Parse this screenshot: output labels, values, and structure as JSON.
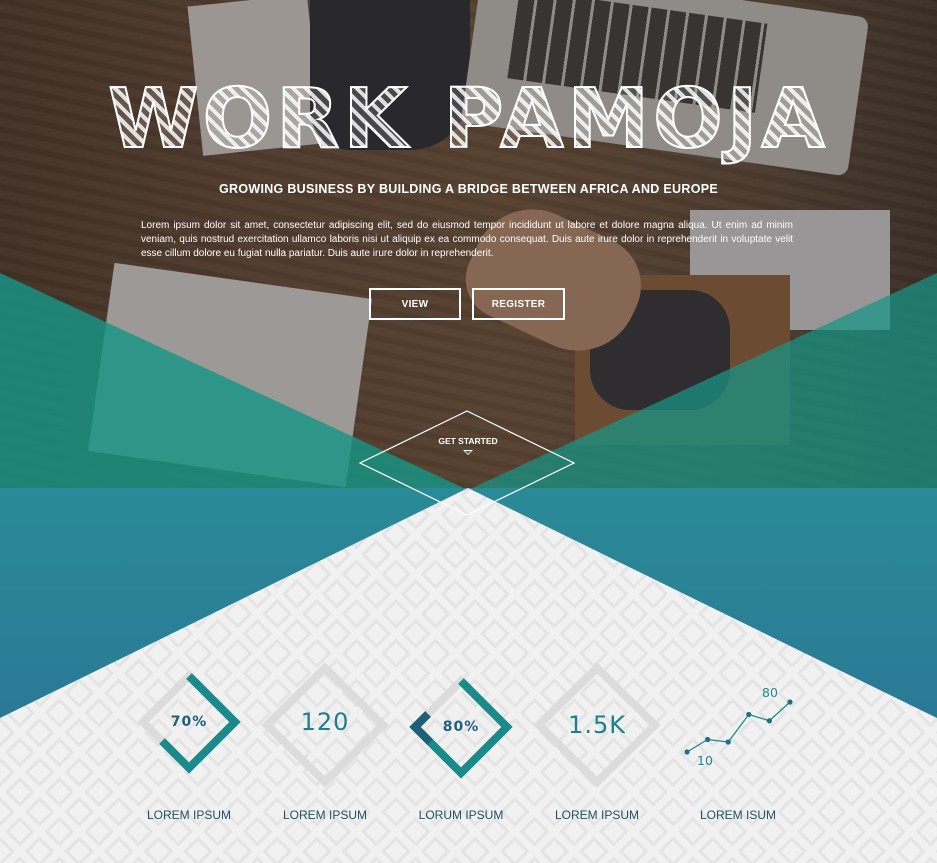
{
  "hero": {
    "title": "WORK PAMOJA",
    "subtitle": "GROWING BUSINESS BY BUILDING A BRIDGE BETWEEN AFRICA AND EUROPE",
    "body": "Lorem ipsum dolor sit amet, consectetur adipiscing elit, sed do eiusmod tempor incididunt ut labore et dolore magna aliqua. Ut enim ad minim veniam, quis nostrud exercitation ullamco laboris nisi ut aliquip ex ea commodo consequat.  Duis aute irure dolor in reprehenderit in voluptate velit esse cillum dolore eu fugiat nulla pariatur. Duis aute irure dolor in reprehenderit.",
    "view_label": "VIEW",
    "register_label": "REGISTER",
    "get_started_label": "GET STARTED"
  },
  "stats": [
    {
      "value": "70%",
      "progress": 0.7,
      "label": "LOREM IPSUM"
    },
    {
      "value": "120",
      "label": "LOREM IPSUM"
    },
    {
      "value": "80%",
      "progress": 0.8,
      "label": "LORUM IPSUM"
    },
    {
      "value": "1.5K",
      "label": "LOREM IPSUM"
    },
    {
      "label": "LOREM ISUM"
    }
  ],
  "chart_data": {
    "type": "line",
    "series": [
      {
        "values": [
          10,
          20,
          18,
          40,
          35,
          50
        ]
      }
    ],
    "annotations": [
      "10",
      "80"
    ]
  },
  "colors": {
    "teal": "#1a9a8a",
    "blue": "#2e7f9a",
    "gradient_dark": "#1f6e8a",
    "pattern_bg": "#f1f1f1",
    "diamond_gray": "#dcdcdc",
    "text_dark": "#1e4f66"
  }
}
